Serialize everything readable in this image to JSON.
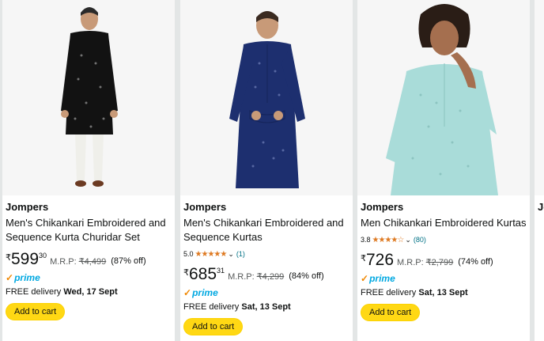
{
  "products": [
    {
      "brand": "Jompers",
      "title_line1": "Men's Chikankari Embroidered and",
      "title_line2": "Sequence Kurta Churidar Set",
      "currency": "₹",
      "price_whole": "599",
      "price_fraction": "30",
      "mrp_label": "M.R.P:",
      "mrp_value": "₹4,499",
      "discount": "(87% off)",
      "prime_label": "prime",
      "delivery_text": "FREE delivery",
      "delivery_date": "Wed, 17 Sept",
      "button_label": "Add to cart",
      "kurta_color": "#121212"
    },
    {
      "brand": "Jompers",
      "title_line1": "Men's Chikankari Embroidered and",
      "title_line2": "Sequence Kurtas",
      "rating_value": "5.0",
      "rating": 5.0,
      "rating_count": "(1)",
      "currency": "₹",
      "price_whole": "685",
      "price_fraction": "31",
      "mrp_label": "M.R.P:",
      "mrp_value": "₹4,299",
      "discount": "(84% off)",
      "prime_label": "prime",
      "delivery_text": "FREE delivery",
      "delivery_date": "Sat, 13 Sept",
      "button_label": "Add to cart",
      "kurta_color": "#1d2f6f"
    },
    {
      "brand": "Jompers",
      "title_line1": "Men Chikankari Embroidered Kurtas",
      "rating_value": "3.8",
      "rating": 3.8,
      "rating_count": "(80)",
      "currency": "₹",
      "price_whole": "726",
      "mrp_label": "M.R.P:",
      "mrp_value": "₹2,799",
      "discount": "(74% off)",
      "prime_label": "prime",
      "delivery_text": "FREE delivery",
      "delivery_date": "Sat, 13 Sept",
      "button_label": "Add to cart",
      "kurta_color": "#a9dcd9"
    },
    {
      "brand": "Jo"
    }
  ]
}
